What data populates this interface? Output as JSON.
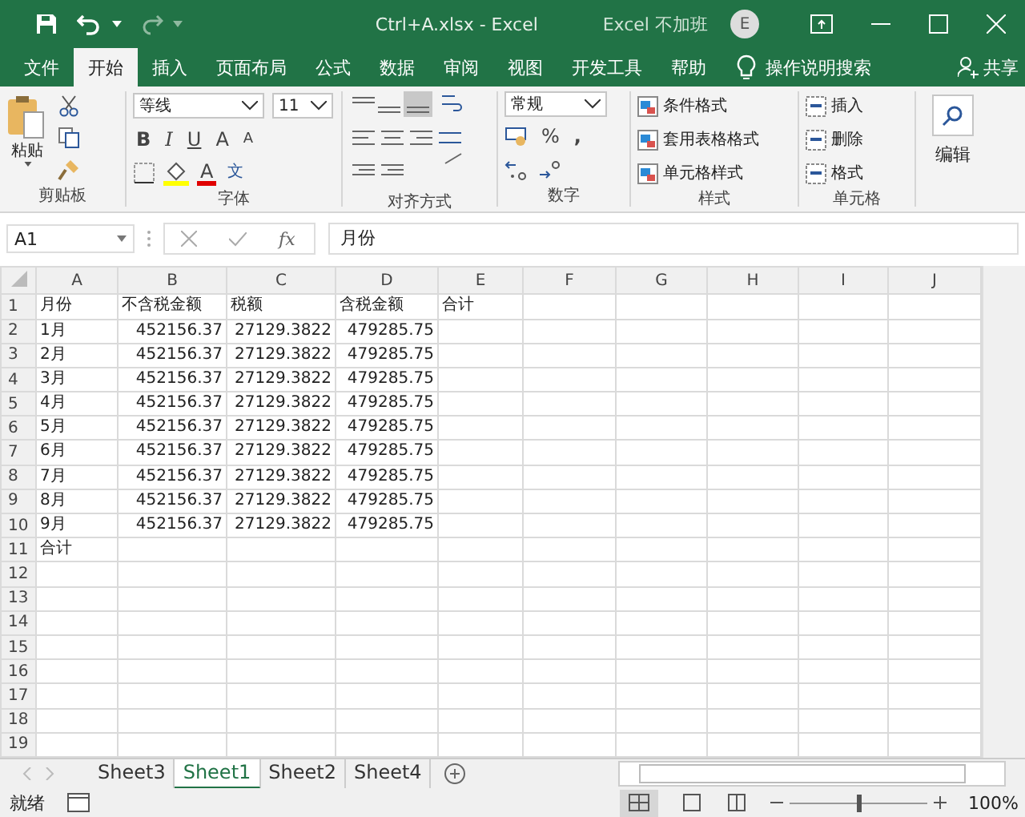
{
  "window": {
    "title": "Ctrl+A.xlsx  -  Excel",
    "user": "Excel 不加班",
    "avatar": "E"
  },
  "ribbon_tabs": [
    {
      "label": "文件",
      "selected": false
    },
    {
      "label": "开始",
      "selected": true
    },
    {
      "label": "插入",
      "selected": false
    },
    {
      "label": "页面布局",
      "selected": false
    },
    {
      "label": "公式",
      "selected": false
    },
    {
      "label": "数据",
      "selected": false
    },
    {
      "label": "审阅",
      "selected": false
    },
    {
      "label": "视图",
      "selected": false
    },
    {
      "label": "开发工具",
      "selected": false
    },
    {
      "label": "帮助",
      "selected": false
    }
  ],
  "tell_me": "操作说明搜索",
  "share": "共享",
  "clipboard": {
    "paste": "粘贴",
    "label": "剪贴板"
  },
  "font": {
    "name": "等线",
    "size": "11",
    "bold": "B",
    "italic": "I",
    "underline": "U",
    "grow": "A",
    "shrink": "A",
    "font_color": "A",
    "phonetic": "文",
    "label": "字体"
  },
  "alignment": {
    "label": "对齐方式"
  },
  "number": {
    "format": "常规",
    "percent": "%",
    "comma": ",",
    "label": "数字"
  },
  "styles": {
    "items": [
      "条件格式",
      "套用表格格式",
      "单元格样式"
    ],
    "label": "样式"
  },
  "cells": {
    "items": [
      "插入",
      "删除",
      "格式"
    ],
    "label": "单元格"
  },
  "editing": {
    "label": "编辑"
  },
  "formula_bar": {
    "name_box": "A1",
    "fx": "fx",
    "value": "月份"
  },
  "columns": [
    "A",
    "B",
    "C",
    "D",
    "E",
    "F",
    "G",
    "H",
    "I",
    "J"
  ],
  "rows": [
    {
      "number": "1",
      "kind": "label",
      "cells": [
        "月份",
        "不含税金额",
        "税额",
        "含税金额",
        "合计"
      ]
    },
    {
      "number": "2",
      "kind": "values",
      "cells": [
        "1月",
        "452156.37",
        "27129.3822",
        "479285.75"
      ]
    },
    {
      "number": "3",
      "kind": "values",
      "cells": [
        "2月",
        "452156.37",
        "27129.3822",
        "479285.75"
      ]
    },
    {
      "number": "4",
      "kind": "values",
      "cells": [
        "3月",
        "452156.37",
        "27129.3822",
        "479285.75"
      ]
    },
    {
      "number": "5",
      "kind": "values",
      "cells": [
        "4月",
        "452156.37",
        "27129.3822",
        "479285.75"
      ]
    },
    {
      "number": "6",
      "kind": "values",
      "cells": [
        "5月",
        "452156.37",
        "27129.3822",
        "479285.75"
      ]
    },
    {
      "number": "7",
      "kind": "values",
      "cells": [
        "6月",
        "452156.37",
        "27129.3822",
        "479285.75"
      ]
    },
    {
      "number": "8",
      "kind": "values",
      "cells": [
        "7月",
        "452156.37",
        "27129.3822",
        "479285.75"
      ]
    },
    {
      "number": "9",
      "kind": "values",
      "cells": [
        "8月",
        "452156.37",
        "27129.3822",
        "479285.75"
      ]
    },
    {
      "number": "10",
      "kind": "values",
      "cells": [
        "9月",
        "452156.37",
        "27129.3822",
        "479285.75"
      ]
    },
    {
      "number": "11",
      "kind": "label",
      "cells": [
        "合计"
      ]
    },
    {
      "number": "12",
      "cells": []
    },
    {
      "number": "13",
      "cells": []
    },
    {
      "number": "14",
      "cells": []
    },
    {
      "number": "15",
      "cells": []
    },
    {
      "number": "16",
      "cells": []
    },
    {
      "number": "17",
      "cells": []
    },
    {
      "number": "18",
      "cells": []
    },
    {
      "number": "19",
      "cells": []
    }
  ],
  "sheets": [
    {
      "label": "Sheet3",
      "selected": false
    },
    {
      "label": "Sheet1",
      "selected": true
    },
    {
      "label": "Sheet2",
      "selected": false
    },
    {
      "label": "Sheet4",
      "selected": false
    }
  ],
  "status": {
    "text": "就绪",
    "zoom": "100%"
  },
  "zoom_slider": {
    "level": 0.5
  }
}
